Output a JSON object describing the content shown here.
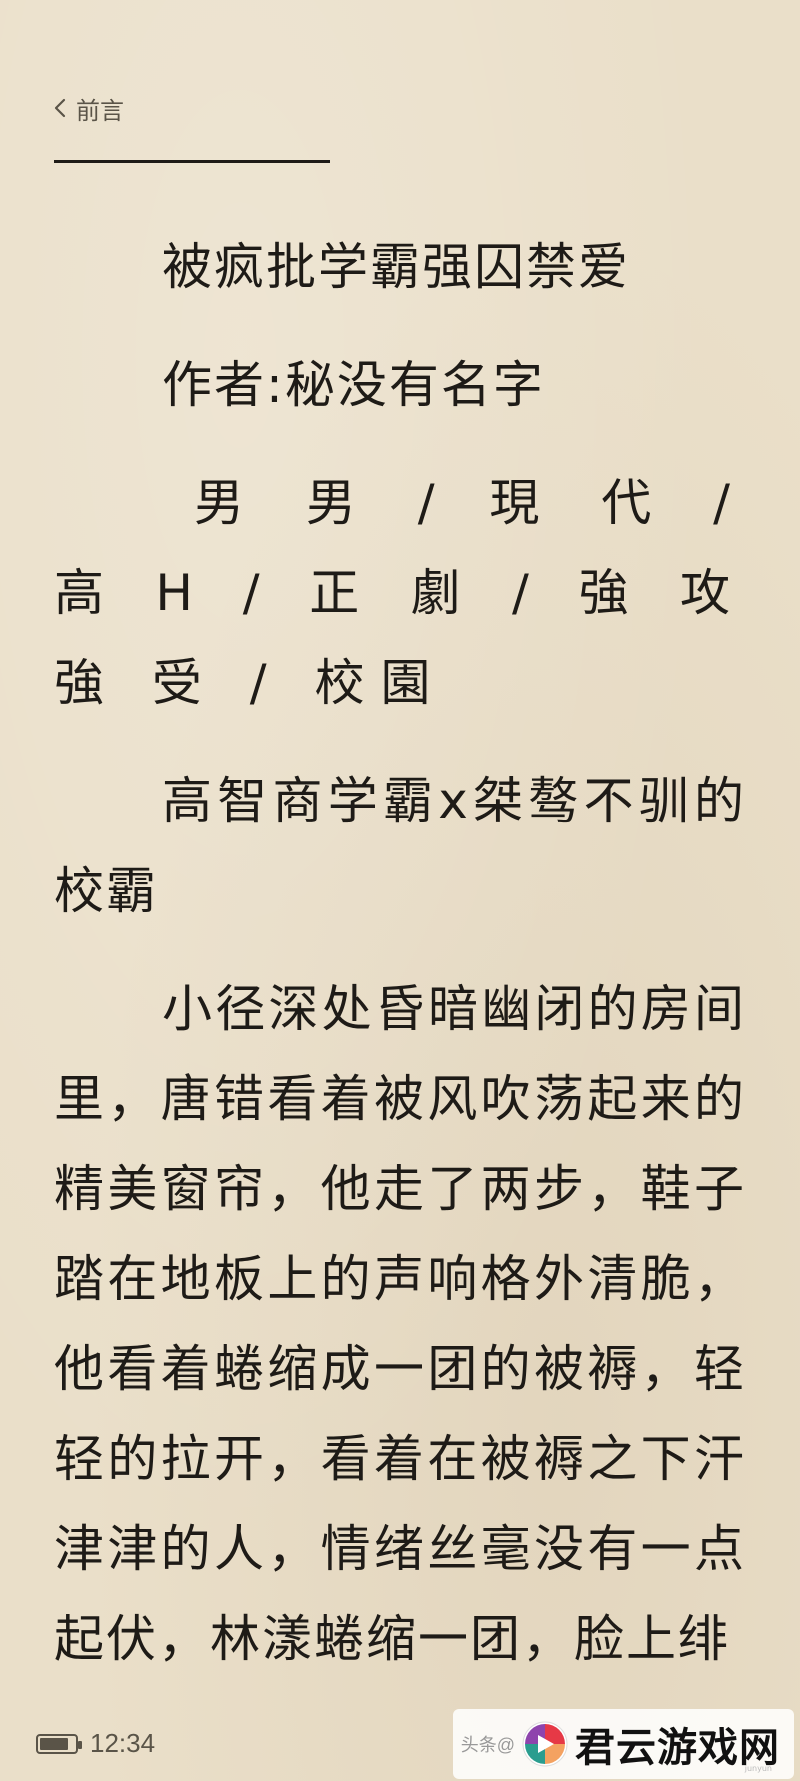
{
  "nav": {
    "back_label": "前言"
  },
  "content": {
    "paragraphs": [
      "被疯批学霸强囚禁爱",
      "作者:秘没有名字",
      "男 男 / 現 代 / 高 H / 正 劇 / 強 攻 強 受 / 校園",
      "高智商学霸x桀骜不驯的校霸",
      "小径深处昏暗幽闭的房间里，唐错看着被风吹荡起来的精美窗帘，他走了两步，鞋子踏在地板上的声响格外清脆，他看着蜷缩成一团的被褥，轻轻的拉开，看着在被褥之下汗津津的人，情绪丝毫没有一点起伏，林漾蜷缩一团，脸上绯"
    ]
  },
  "status_bar": {
    "time": "12:34",
    "battery_level": 0.85
  },
  "watermark": {
    "prefix": "头条@",
    "brand": "君云游戏网",
    "sub": "junyun"
  },
  "colors": {
    "paper": "#eadfc9",
    "text": "#1e1b17",
    "muted": "#5a5448"
  }
}
